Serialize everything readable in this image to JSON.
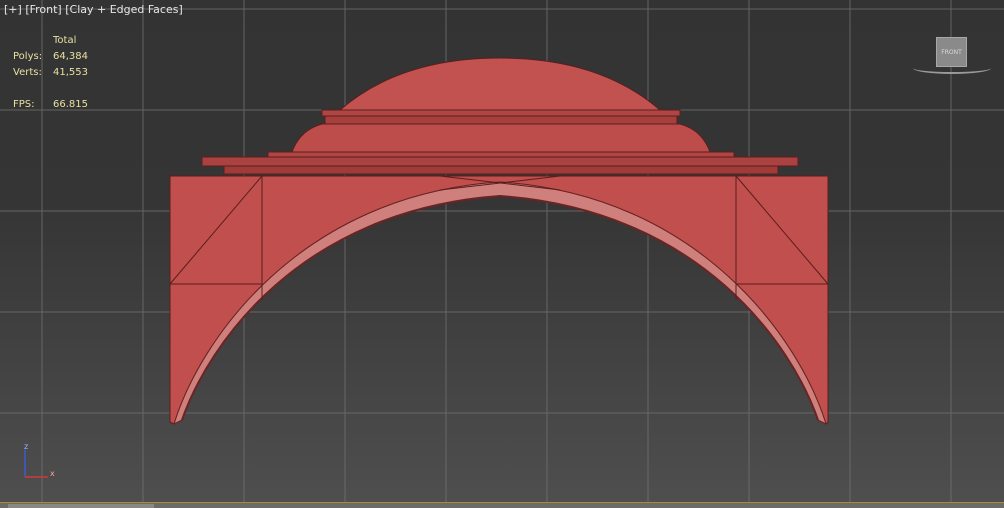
{
  "viewport": {
    "label_parts": [
      "[+]",
      "[Front]",
      "[Clay + Edged Faces]"
    ]
  },
  "stats": {
    "header": "Total",
    "polys_label": "Polys:",
    "polys_value": "64,384",
    "verts_label": "Verts:",
    "verts_value": "41,553",
    "fps_label": "FPS:",
    "fps_value": "66.815"
  },
  "viewcube": {
    "face_label": "FRONT"
  },
  "axis": {
    "z_label": "z",
    "x_label": "x"
  },
  "colors": {
    "model": "#b84a48",
    "model_dark": "#7a2a2a",
    "grid": "#6e6e6e",
    "axis_z": "#3b5bd0",
    "axis_x": "#d03b3b",
    "stats_text": "#e8e0a0"
  }
}
